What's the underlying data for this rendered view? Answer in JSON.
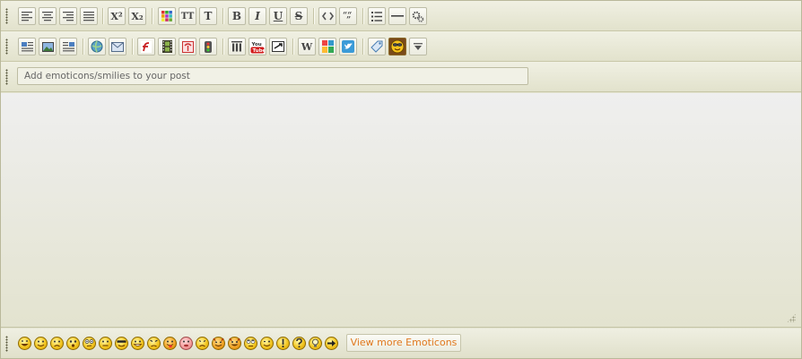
{
  "toolbar": {
    "row1": [
      "align-left-icon",
      "align-center-icon",
      "align-right-icon",
      "align-justify-icon",
      "superscript-icon",
      "subscript-icon",
      "color-palette-icon",
      "font-size-icon",
      "font-face-icon",
      "bold-icon",
      "italic-icon",
      "underline-icon",
      "strikethrough-icon",
      "code-icon",
      "quote-icon",
      "bulleted-list-icon",
      "horizontal-rule-icon",
      "more-settings-icon"
    ],
    "row1_labels": {
      "superscript": "X²",
      "subscript": "X₂",
      "font_size": "TT",
      "font_face": "T",
      "bold": "B",
      "italic": "I",
      "underline": "U",
      "strike": "S"
    },
    "row2": [
      "image-left-icon",
      "image-icon",
      "image-right-icon",
      "link-globe-icon",
      "email-icon",
      "flash-icon",
      "video-film-icon",
      "iframe-icon",
      "traffic-icon",
      "columns-icon",
      "youtube-icon",
      "embed-icon",
      "wikipedia-icon",
      "google-icon",
      "twitter-icon",
      "tag-icon",
      "emoticon-icon",
      "collapse-icon"
    ],
    "youtube_label": "You Tube",
    "wikipedia_label": "W"
  },
  "emoticon_input": {
    "placeholder": "Add emoticons/smilies to your post"
  },
  "emoticons": [
    "laugh-icon",
    "smile-icon",
    "sad-icon",
    "surprised-icon",
    "confused-icon",
    "neutral-icon",
    "cool-icon",
    "grin-icon",
    "angry-icon",
    "tongue-icon",
    "embarrassed-icon",
    "frown-icon",
    "evil-icon",
    "twisted-icon",
    "rolling-eyes-icon",
    "wink-icon",
    "exclaim-icon",
    "question-icon",
    "idea-icon",
    "arrow-icon"
  ],
  "view_more_label": "View more Emoticons"
}
